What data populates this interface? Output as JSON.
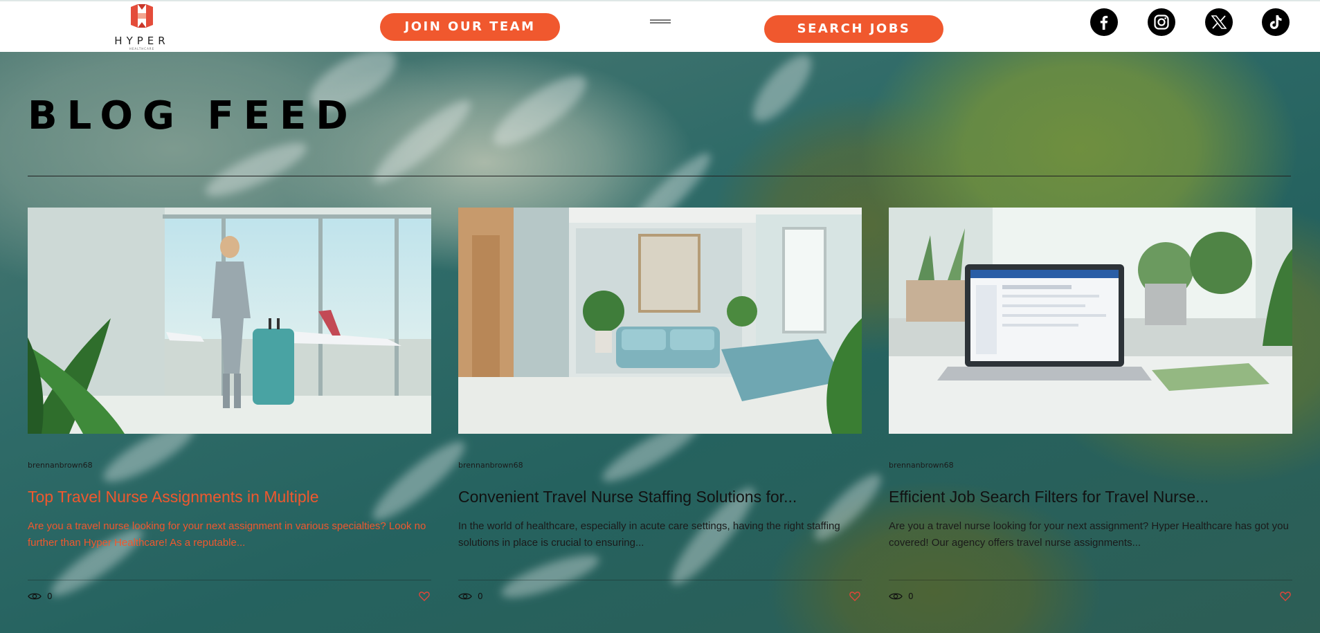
{
  "brand": {
    "name": "HYPER",
    "tagline": "HEALTHCARE",
    "accent": "#f0582e"
  },
  "header": {
    "join_label": "JOIN OUR TEAM",
    "search_label": "SEARCH JOBS",
    "social": [
      "facebook-icon",
      "instagram-icon",
      "x-icon",
      "tiktok-icon"
    ]
  },
  "page": {
    "title": "BLOG FEED"
  },
  "posts": [
    {
      "author": "brennanbrown68",
      "title": "Top Travel Nurse Assignments in Multiple",
      "excerpt": "Are you a travel nurse looking for your next assignment in various specialties? Look no further than Hyper Healthcare! As a reputable...",
      "views": "0",
      "image": "nurse-with-suitcase-at-airport"
    },
    {
      "author": "brennanbrown68",
      "title": "Convenient Travel Nurse Staffing Solutions for...",
      "excerpt": "In the world of healthcare, especially in acute care settings, having the right staffing solutions in place is crucial to ensuring...",
      "views": "0",
      "image": "clinic-waiting-room"
    },
    {
      "author": "brennanbrown68",
      "title": "Efficient Job Search Filters for Travel Nurse...",
      "excerpt": "Are you a travel nurse looking for your next assignment? Hyper Healthcare has got you covered! Our agency offers travel nurse assignments...",
      "views": "0",
      "image": "laptop-job-search"
    }
  ]
}
